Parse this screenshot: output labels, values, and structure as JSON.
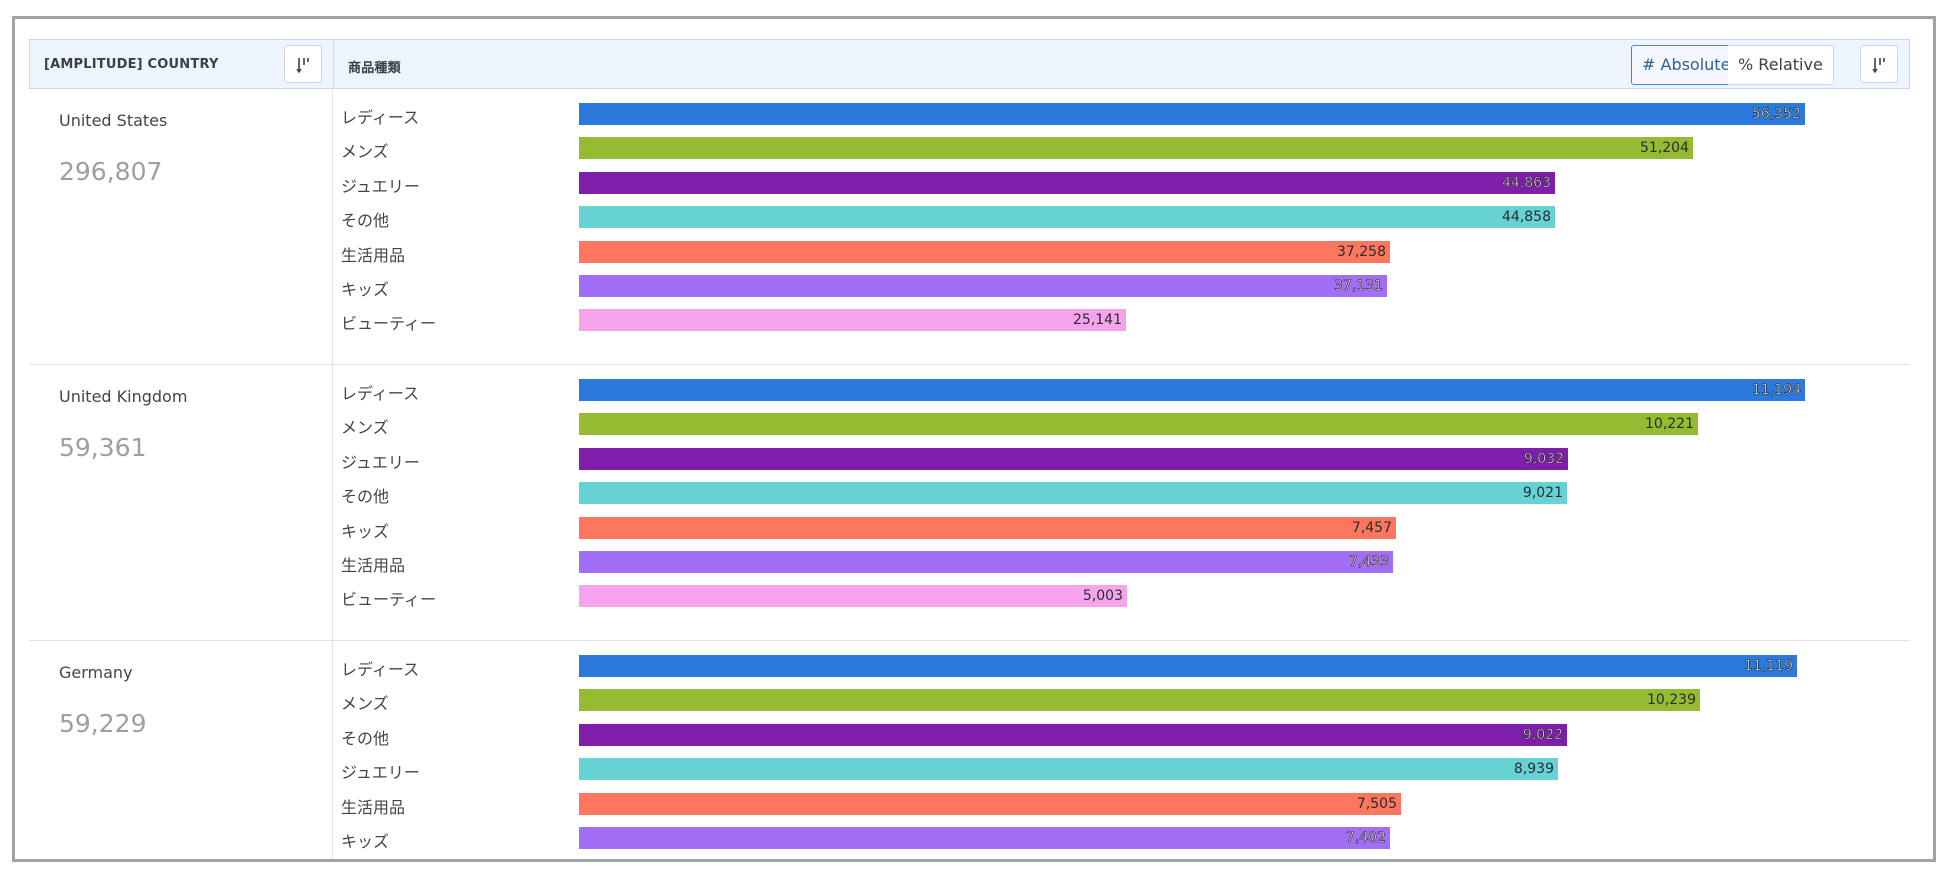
{
  "header": {
    "left_title": "[AMPLITUDE] COUNTRY",
    "right_title": "商品種類",
    "absolute_label": "# Absolute",
    "relative_label": "% Relative"
  },
  "colors": {
    "blue": "#2b79dd",
    "green": "#95bb32",
    "purple": "#7f1eaa",
    "teal": "#67d2d4",
    "coral": "#fe765d",
    "lavender": "#a36ef6",
    "pink": "#f5a3ec"
  },
  "chart_data": {
    "type": "bar",
    "orientation": "horizontal",
    "mode": "absolute",
    "xlim": [
      0,
      58000
    ],
    "groups": [
      {
        "country": "United States",
        "total": "296,807",
        "bars": [
          {
            "label": "レディース",
            "value": 56352,
            "display": "56,352",
            "color": "#2b79dd"
          },
          {
            "label": "メンズ",
            "value": 51204,
            "display": "51,204",
            "color": "#95bb32"
          },
          {
            "label": "ジュエリー",
            "value": 44863,
            "display": "44,863",
            "color": "#7f1eaa"
          },
          {
            "label": "その他",
            "value": 44858,
            "display": "44,858",
            "color": "#67d2d4"
          },
          {
            "label": "生活用品",
            "value": 37258,
            "display": "37,258",
            "color": "#fe765d"
          },
          {
            "label": "キッズ",
            "value": 37131,
            "display": "37,131",
            "color": "#a36ef6"
          },
          {
            "label": "ビューティー",
            "value": 25141,
            "display": "25,141",
            "color": "#f5a3ec"
          }
        ]
      },
      {
        "country": "United Kingdom",
        "total": "59,361",
        "bars": [
          {
            "label": "レディース",
            "value": 11194,
            "display": "11,194",
            "color": "#2b79dd"
          },
          {
            "label": "メンズ",
            "value": 10221,
            "display": "10,221",
            "color": "#95bb32"
          },
          {
            "label": "ジュエリー",
            "value": 9032,
            "display": "9,032",
            "color": "#7f1eaa"
          },
          {
            "label": "その他",
            "value": 9021,
            "display": "9,021",
            "color": "#67d2d4"
          },
          {
            "label": "キッズ",
            "value": 7457,
            "display": "7,457",
            "color": "#fe765d"
          },
          {
            "label": "生活用品",
            "value": 7433,
            "display": "7,433",
            "color": "#a36ef6"
          },
          {
            "label": "ビューティー",
            "value": 5003,
            "display": "5,003",
            "color": "#f5a3ec"
          }
        ]
      },
      {
        "country": "Germany",
        "total": "59,229",
        "bars": [
          {
            "label": "レディース",
            "value": 11119,
            "display": "11,119",
            "color": "#2b79dd"
          },
          {
            "label": "メンズ",
            "value": 10239,
            "display": "10,239",
            "color": "#95bb32"
          },
          {
            "label": "その他",
            "value": 9022,
            "display": "9,022",
            "color": "#7f1eaa"
          },
          {
            "label": "ジュエリー",
            "value": 8939,
            "display": "8,939",
            "color": "#67d2d4"
          },
          {
            "label": "生活用品",
            "value": 7505,
            "display": "7,505",
            "color": "#fe765d"
          },
          {
            "label": "キッズ",
            "value": 7402,
            "display": "7,402",
            "color": "#a36ef6"
          }
        ]
      }
    ]
  }
}
